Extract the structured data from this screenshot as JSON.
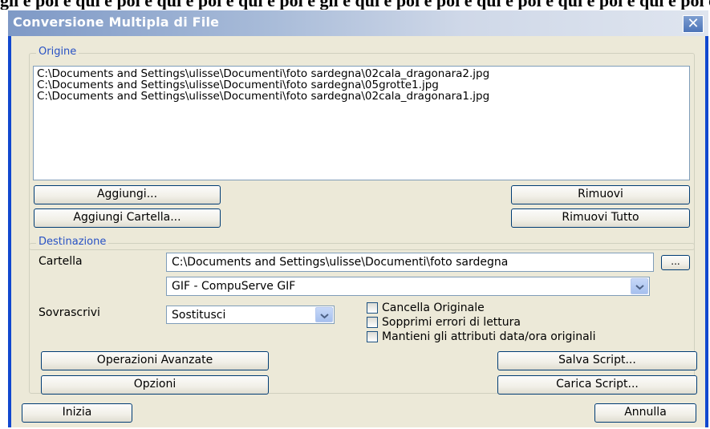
{
  "header_strip": "gli e poi e qui e poi e qui e poi e qui e poi e gli e qui e poi e poi e qui e poi e qui e poi e qui e poi e",
  "window": {
    "title": "Conversione Multipla di File",
    "close_glyph": "✕"
  },
  "origine": {
    "legend": "Origine",
    "files": [
      "C:\\Documents and Settings\\ulisse\\Documenti\\foto sardegna\\02cala_dragonara2.jpg",
      "C:\\Documents and Settings\\ulisse\\Documenti\\foto sardegna\\05grotte1.jpg",
      "C:\\Documents and Settings\\ulisse\\Documenti\\foto sardegna\\02cala_dragonara1.jpg"
    ],
    "add_label": "Aggiungi...",
    "add_folder_label": "Aggiungi Cartella...",
    "remove_label": "Rimuovi",
    "remove_all_label": "Rimuovi Tutto"
  },
  "destinazione": {
    "legend": "Destinazione",
    "folder_label": "Cartella",
    "folder_value": "C:\\Documents and Settings\\ulisse\\Documenti\\foto sardegna",
    "browse_label": "...",
    "format_value": "GIF - CompuServe GIF",
    "overwrite_label": "Sovrascrivi",
    "overwrite_value": "Sostitusci",
    "checkbox_delete": "Cancella Originale",
    "checkbox_suppress": "Sopprimi errori di lettura",
    "checkbox_keep_dates": "Mantieni gli attributi data/ora originali",
    "checked": {
      "delete": false,
      "suppress": false,
      "keep_dates": false
    },
    "advanced_label": "Operazioni Avanzate",
    "options_label": "Opzioni",
    "save_script_label": "Salva Script...",
    "load_script_label": "Carica Script..."
  },
  "footer": {
    "start_label": "Inizia",
    "cancel_label": "Annulla"
  },
  "colors": {
    "window_border": "#1148cf",
    "dialog_bg": "#ece9d8",
    "legend_text": "#2751c4"
  }
}
